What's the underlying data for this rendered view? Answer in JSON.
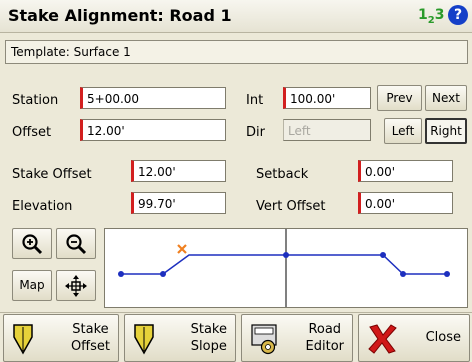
{
  "title": "Stake Alignment: Road 1",
  "number_mode_icon": "123",
  "help_icon": "?",
  "template_label": "Template: Surface 1",
  "station": {
    "label": "Station",
    "value": "5+00.00"
  },
  "int": {
    "label": "Int",
    "value": "100.00'"
  },
  "prev_label": "Prev",
  "next_label": "Next",
  "offset": {
    "label": "Offset",
    "value": "12.00'"
  },
  "dir": {
    "label": "Dir",
    "value": "Left"
  },
  "left_label": "Left",
  "right_label": "Right",
  "stake_offset": {
    "label": "Stake Offset",
    "value": "12.00'"
  },
  "setback": {
    "label": "Setback",
    "value": "0.00'"
  },
  "elevation": {
    "label": "Elevation",
    "value": "99.70'"
  },
  "vert_offset": {
    "label": "Vert Offset",
    "value": "0.00'"
  },
  "map_label": "Map",
  "toolbar": {
    "stake_offset_label": "Stake\nOffset",
    "stake_slope_label": "Stake\nSlope",
    "road_editor_label": "Road\nEditor",
    "close_label": "Close"
  },
  "colors": {
    "accent_red": "#d21f1f",
    "help_blue": "#1540c8",
    "graph_line": "#1d2fbf",
    "stake_marker": "#f08020"
  }
}
